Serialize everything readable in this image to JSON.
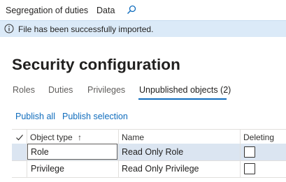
{
  "topnav": {
    "item1": "Segregation of duties",
    "item2": "Data",
    "search_icon": "search-icon"
  },
  "banner": {
    "icon": "info-icon",
    "text": "File has been successfully imported."
  },
  "page": {
    "title": "Security configuration"
  },
  "tabs": [
    {
      "label": "Roles",
      "active": false
    },
    {
      "label": "Duties",
      "active": false
    },
    {
      "label": "Privileges",
      "active": false
    },
    {
      "label": "Unpublished objects (2)",
      "active": true
    }
  ],
  "actions": {
    "publish_all": "Publish all",
    "publish_selection": "Publish selection"
  },
  "grid": {
    "check_icon": "checkmark-icon",
    "columns": [
      "Object type",
      "Name",
      "Deleting"
    ],
    "sort_indicator": "↑",
    "rows": [
      {
        "type": "Role",
        "name": "Read Only Role",
        "deleting": false,
        "selected": true
      },
      {
        "type": "Privilege",
        "name": "Read Only Privilege",
        "deleting": false,
        "selected": false
      }
    ]
  },
  "colors": {
    "accent": "#0f6cbd",
    "banner_bg": "#dbeaf8",
    "selected_row": "#dbe5f1"
  }
}
